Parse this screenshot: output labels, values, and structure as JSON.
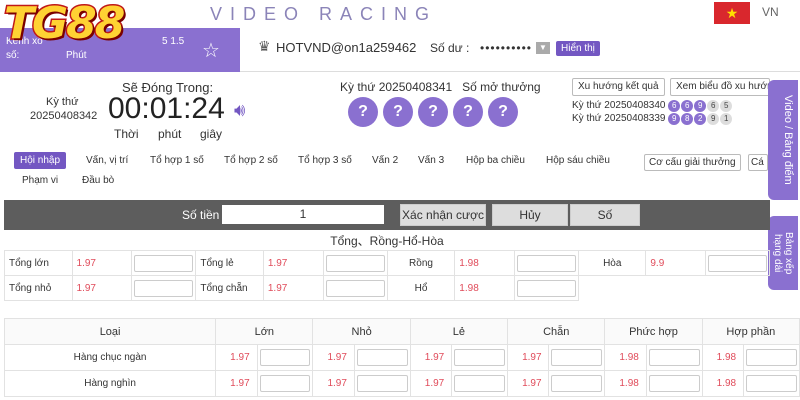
{
  "brand": {
    "logo": "TG88",
    "title": "VIDEO RACING",
    "lang": "VN",
    "flag_color": "#d9272d",
    "accent": "#8a70d0"
  },
  "account": {
    "left_line1": "Kênh xổ",
    "left_line2": "số:",
    "left_phut": "Phút",
    "left_ver": "5 1.5",
    "username": "HOTVND@on1a259462",
    "balance_label": "Số dư :",
    "balance_value": "••••••••••",
    "show_label": "Hiển thị"
  },
  "timer": {
    "draw_label": "Kỳ thứ",
    "draw_number": "20250408342",
    "title": "Sẽ Đóng Trong:",
    "value": "00:01:24",
    "unit_hour": "Thời",
    "unit_min": "phút",
    "unit_sec": "giây"
  },
  "result": {
    "draw_label": "Kỳ thứ 20250408341",
    "numbers_label": "Số mở thưởng",
    "balls": [
      "?",
      "?",
      "?",
      "?",
      "?"
    ]
  },
  "history": {
    "trend_btn": "Xu hướng kết quả",
    "chart_btn": "Xem biểu đồ xu hướng",
    "rows": [
      {
        "label": "Kỳ thứ 20250408340",
        "balls": [
          "6",
          "6",
          "9",
          "6",
          "5"
        ]
      },
      {
        "label": "Kỳ thứ 20250408339",
        "balls": [
          "9",
          "8",
          "2",
          "9",
          "1"
        ]
      }
    ]
  },
  "side_tabs": {
    "video": "Video / Bảng điểm",
    "ranking": "Bảng xếp hạng dài"
  },
  "bet_tabs": {
    "items": [
      "Hội nhập",
      "Vấn, vị trí",
      "Tổ hợp 1 số",
      "Tổ hợp 2 số",
      "Tổ hợp 3 số",
      "Vấn 2",
      "Vấn 3",
      "Hộp ba chiều",
      "Hộp sáu chiều",
      "Phạm vi",
      "Đầu bò"
    ],
    "prize_btn": "Cơ cấu giải thưởng",
    "prize_btn2": "Cá"
  },
  "amount_bar": {
    "label": "Số tiền",
    "value": "1",
    "confirm": "Xác nhận cược",
    "cancel": "Hủy",
    "number": "Số"
  },
  "section1": {
    "title": "Tổng、Rồng-Hổ-Hòa",
    "rows": [
      [
        {
          "label": "Tổng lớn",
          "odd": "1.97"
        },
        {
          "label": "Tổng lẻ",
          "odd": "1.97"
        },
        {
          "label": "Rồng",
          "odd": "1.98"
        },
        {
          "label": "Hòa",
          "odd": "9.9"
        }
      ],
      [
        {
          "label": "Tổng nhỏ",
          "odd": "1.97"
        },
        {
          "label": "Tổng chẵn",
          "odd": "1.97"
        },
        {
          "label": "Hổ",
          "odd": "1.98"
        }
      ]
    ]
  },
  "section2": {
    "headers": [
      "Loại",
      "Lớn",
      "Nhỏ",
      "Lẻ",
      "Chẵn",
      "Phức hợp",
      "Hợp phần"
    ],
    "rows": [
      {
        "name": "Hàng chục ngàn",
        "odds": [
          "1.97",
          "1.97",
          "1.97",
          "1.97",
          "1.98",
          "1.98"
        ]
      },
      {
        "name": "Hàng nghìn",
        "odds": [
          "1.97",
          "1.97",
          "1.97",
          "1.97",
          "1.98",
          "1.98"
        ]
      }
    ]
  }
}
